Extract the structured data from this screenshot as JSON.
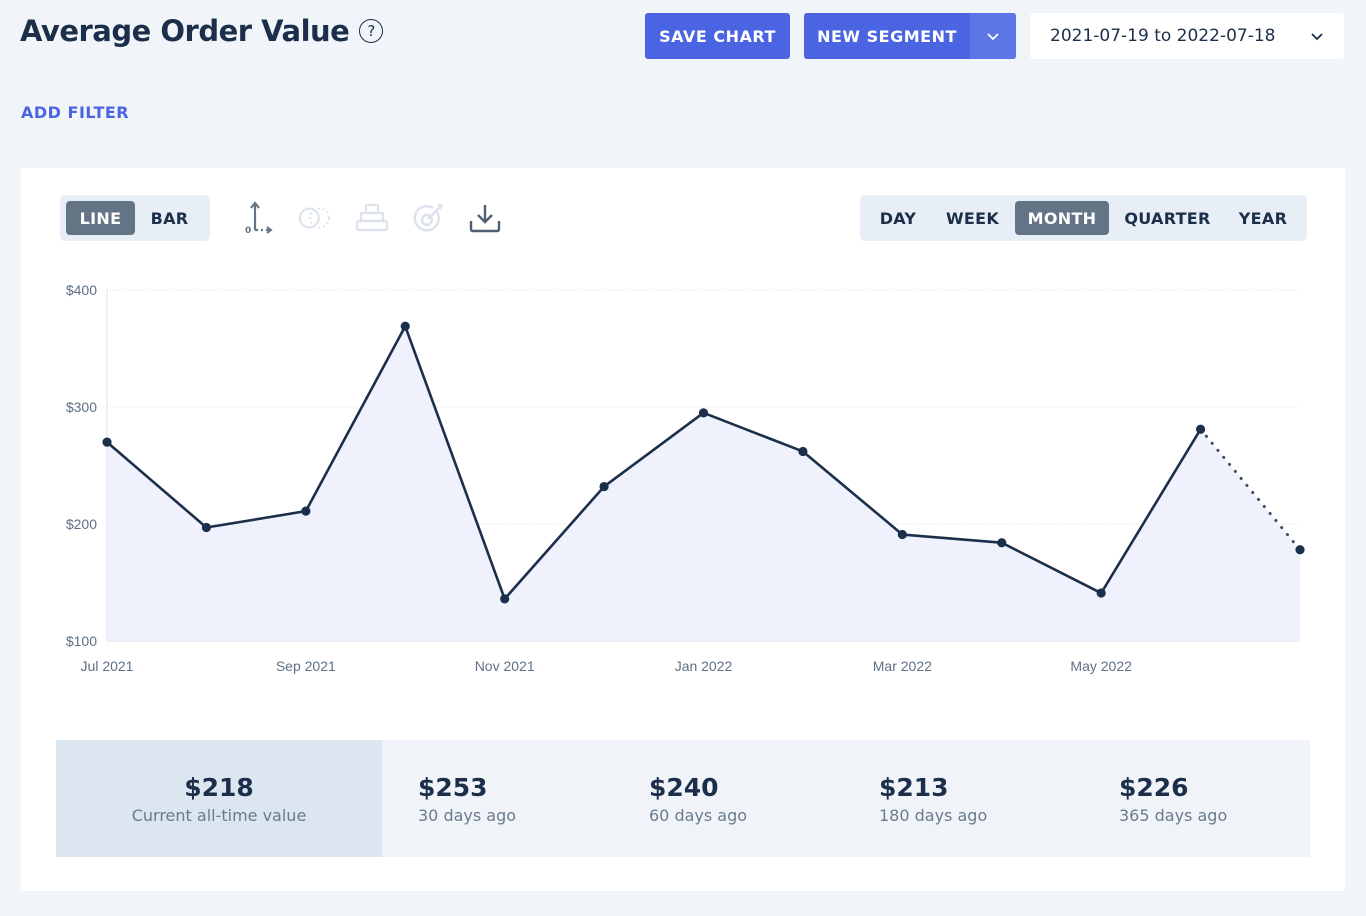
{
  "header": {
    "title": "Average Order Value",
    "help_icon": "question-circle-icon",
    "save_chart_label": "SAVE CHART",
    "new_segment_label": "NEW SEGMENT",
    "date_range": "2021-07-19 to 2022-07-18",
    "add_filter_label": "ADD FILTER"
  },
  "colors": {
    "accent": "#4a64e2",
    "line": "#1c2f4a",
    "area_fill": "#eff2fd",
    "active_toggle": "#637487"
  },
  "toolbar": {
    "chart_types": [
      {
        "label": "LINE",
        "active": true
      },
      {
        "label": "BAR",
        "active": false
      }
    ],
    "tools": [
      {
        "icon": "axis-zero-icon",
        "enabled": true
      },
      {
        "icon": "compare-circles-icon",
        "enabled": false
      },
      {
        "icon": "stack-icon",
        "enabled": false
      },
      {
        "icon": "target-goal-icon",
        "enabled": false
      },
      {
        "icon": "download-icon",
        "enabled": true
      }
    ],
    "intervals": [
      {
        "label": "DAY",
        "active": false
      },
      {
        "label": "WEEK",
        "active": false
      },
      {
        "label": "MONTH",
        "active": true
      },
      {
        "label": "QUARTER",
        "active": false
      },
      {
        "label": "YEAR",
        "active": false
      }
    ]
  },
  "chart_data": {
    "type": "area",
    "title": "Average Order Value",
    "xlabel": "",
    "ylabel": "",
    "x": [
      "Jul 2021",
      "Aug 2021",
      "Sep 2021",
      "Oct 2021",
      "Nov 2021",
      "Dec 2021",
      "Jan 2022",
      "Feb 2022",
      "Mar 2022",
      "Apr 2022",
      "May 2022",
      "Jun 2022",
      "Jul 2022"
    ],
    "series": [
      {
        "name": "Average Order Value",
        "values": [
          270,
          197,
          211,
          369,
          136,
          232,
          295,
          262,
          191,
          184,
          141,
          281,
          178
        ],
        "last_segment_dotted": true
      }
    ],
    "ylim": [
      100,
      400
    ],
    "yticks": [
      100,
      200,
      300,
      400
    ],
    "ytick_labels": [
      "$100",
      "$200",
      "$300",
      "$400"
    ],
    "xtick_labels": [
      {
        "index": 0,
        "label": "Jul 2021"
      },
      {
        "index": 2,
        "label": "Sep 2021"
      },
      {
        "index": 4,
        "label": "Nov 2021"
      },
      {
        "index": 6,
        "label": "Jan 2022"
      },
      {
        "index": 8,
        "label": "Mar 2022"
      },
      {
        "index": 10,
        "label": "May 2022"
      }
    ],
    "grid": true,
    "legend": "none"
  },
  "stats": [
    {
      "value": "$218",
      "label": "Current all-time value",
      "current": true
    },
    {
      "value": "$253",
      "label": "30 days ago"
    },
    {
      "value": "$240",
      "label": "60 days ago"
    },
    {
      "value": "$213",
      "label": "180 days ago"
    },
    {
      "value": "$226",
      "label": "365 days ago"
    }
  ]
}
